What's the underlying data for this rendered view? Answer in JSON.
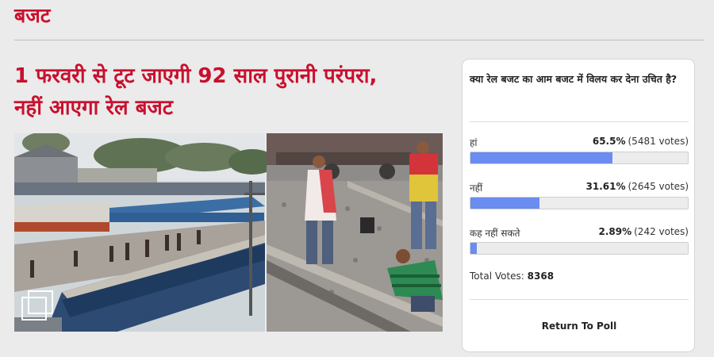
{
  "section": {
    "title": "बजट"
  },
  "article": {
    "headline_line1": "1 फरवरी से टूट जाएगी 92 साल पुरानी परंपरा,",
    "headline_line2": "नहीं आएगा रेल बजट"
  },
  "poll": {
    "question": "क्या रेल बजट का आम बजट में विलय कर देना उचित है?",
    "options": [
      {
        "label": "हां",
        "percent": "65.5%",
        "votes": "(5481 votes)",
        "fill": 0.655
      },
      {
        "label": "नहीं",
        "percent": "31.61%",
        "votes": "(2645 votes)",
        "fill": 0.3161
      },
      {
        "label": "कह नहीं सकते",
        "percent": "2.89%",
        "votes": "(242 votes)",
        "fill": 0.0289
      }
    ],
    "total_label": "Total Votes:",
    "total_value": "8368",
    "return_label": "Return To Poll",
    "bar_color": "#6b8cf0"
  },
  "colors": {
    "accent": "#c8102e"
  },
  "icons": {
    "gallery": "gallery-icon"
  }
}
